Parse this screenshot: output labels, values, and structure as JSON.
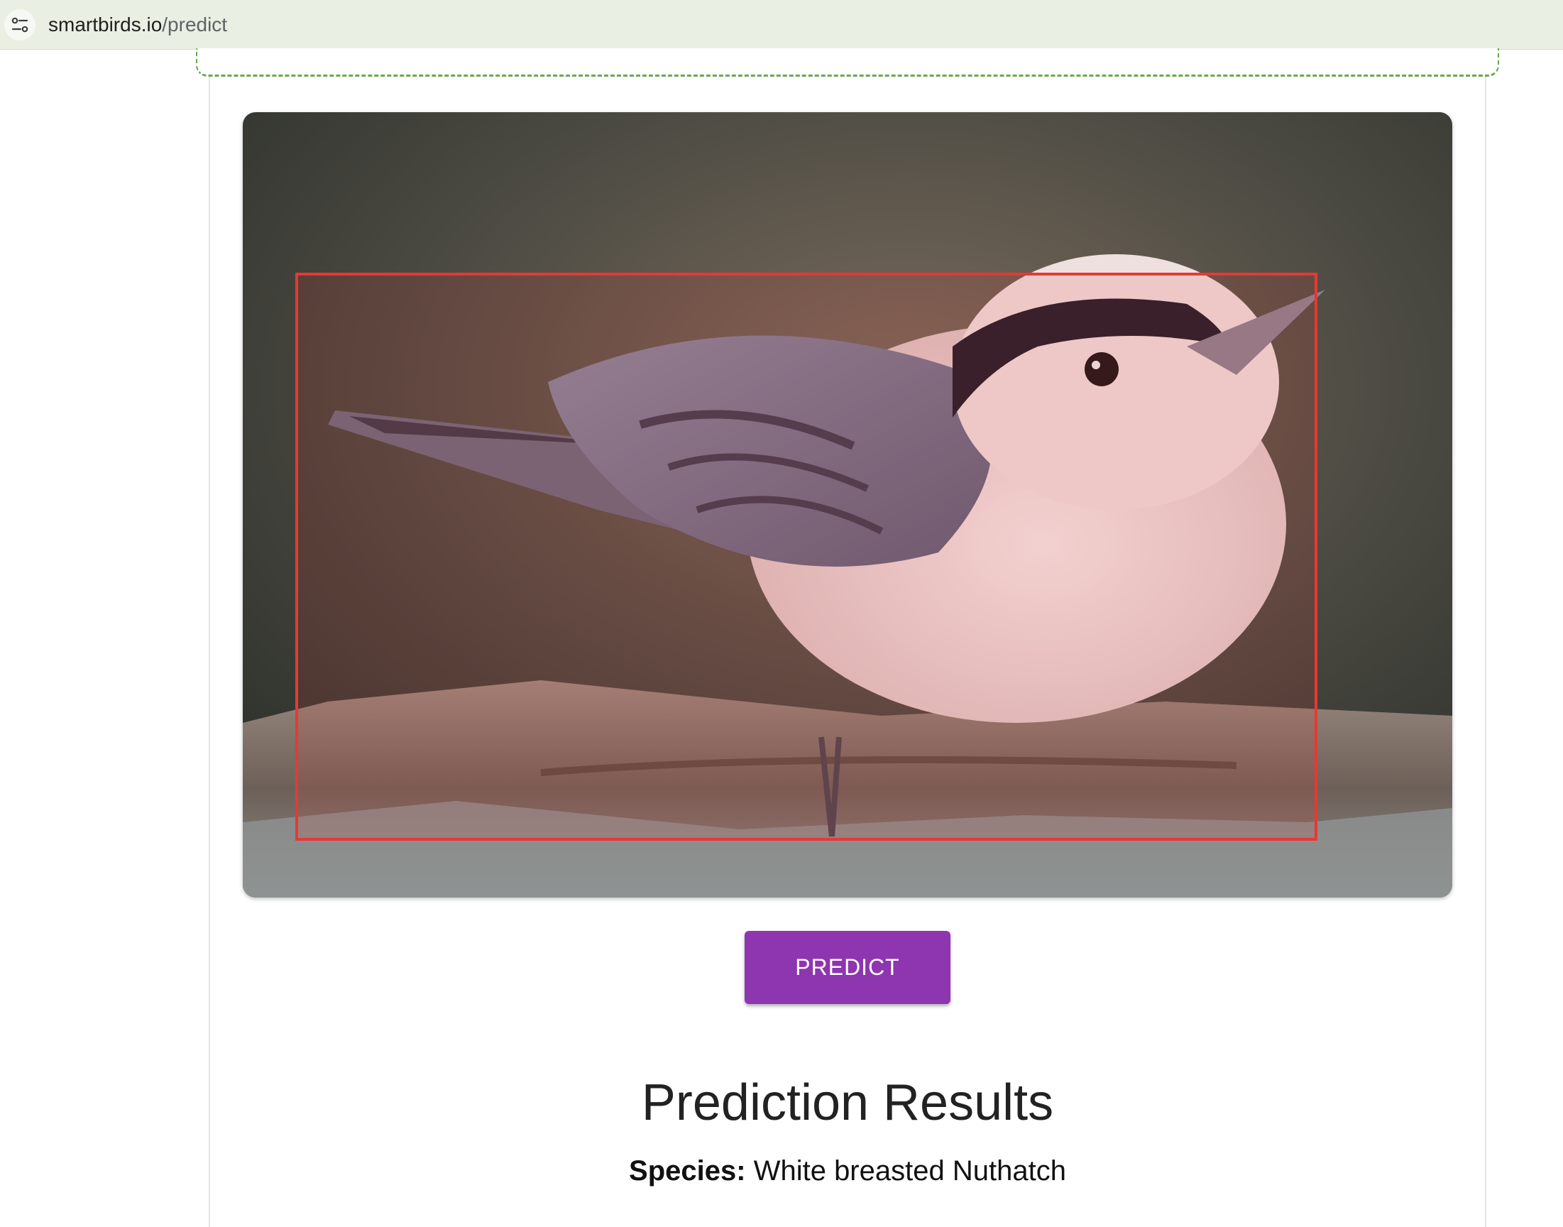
{
  "browser": {
    "url_host": "smartbirds.io",
    "url_path": "/predict",
    "site_info_icon": "tune-icon"
  },
  "image": {
    "subject": "bird",
    "bounding_box_color": "#e53935"
  },
  "actions": {
    "predict_label": "PREDICT",
    "predict_color": "#8e35b0"
  },
  "results": {
    "title": "Prediction Results",
    "species_label": "Species:",
    "species_value": "White breasted Nuthatch"
  }
}
